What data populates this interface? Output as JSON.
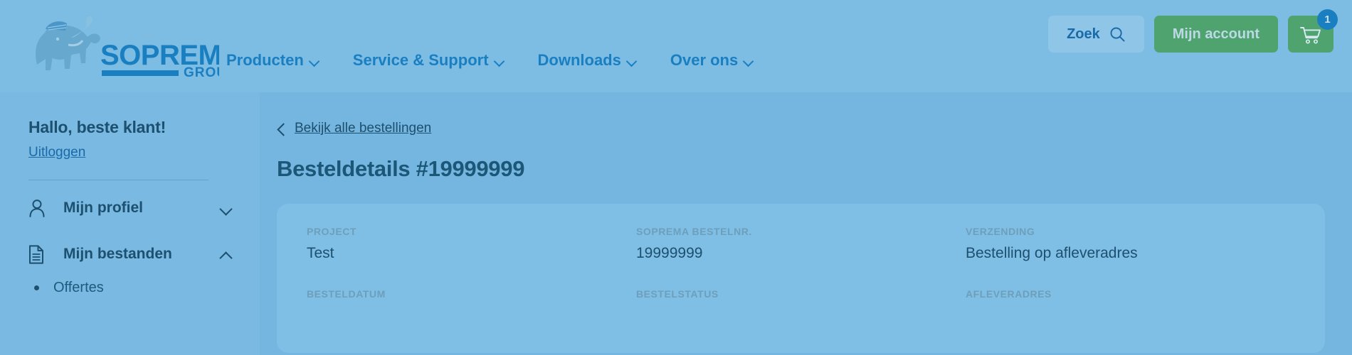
{
  "header": {
    "logo": {
      "name": "soprema-group-logo",
      "wordmark": "SOPREMA",
      "subtitle": "GROUP"
    },
    "nav": [
      {
        "label": "Producten",
        "icon": "chevron-down-icon"
      },
      {
        "label": "Service & Support",
        "icon": "chevron-down-icon"
      },
      {
        "label": "Downloads",
        "icon": "chevron-down-icon"
      },
      {
        "label": "Over ons",
        "icon": "chevron-down-icon"
      }
    ],
    "search_button": {
      "label": "Zoek",
      "icon": "search-icon"
    },
    "account_button": {
      "label": "Mijn account"
    },
    "cart_button": {
      "icon": "shopping-cart-icon",
      "badge_count": "1"
    }
  },
  "sidebar": {
    "greeting": "Hallo, beste klant!",
    "logout_label": "Uitloggen",
    "items": [
      {
        "label": "Mijn profiel",
        "icon": "user-icon",
        "chevron": "chevron-down-icon",
        "expanded": false
      },
      {
        "label": "Mijn bestanden",
        "icon": "document-icon",
        "chevron": "chevron-up-icon",
        "expanded": true
      }
    ],
    "subitems": [
      {
        "label": "Offertes"
      }
    ]
  },
  "main": {
    "back_link": {
      "label": "Bekijk alle bestellingen",
      "icon": "chevron-left-icon"
    },
    "page_title": "Besteldetails #19999999",
    "details_card": {
      "fields": [
        {
          "label": "PROJECT",
          "value": "Test"
        },
        {
          "label": "SOPREMA BESTELNR.",
          "value": "19999999"
        },
        {
          "label": "VERZENDING",
          "value": "Bestelling op afleveradres"
        },
        {
          "label": "BESTELDATUM",
          "value": ""
        },
        {
          "label": "BESTELSTATUS",
          "value": ""
        },
        {
          "label": "AFLEVERADRES",
          "value": ""
        }
      ]
    }
  },
  "colors": {
    "page_background": "#7dbce3",
    "sidebar_background": "#79b9e2",
    "main_background": "#75b6e0",
    "card_background": "#7fbee5",
    "brand_blue": "#1a7fc1",
    "accent_green": "#4fa36e",
    "text_dark_blue": "#1d4f6e",
    "label_muted": "#6e9fba"
  }
}
